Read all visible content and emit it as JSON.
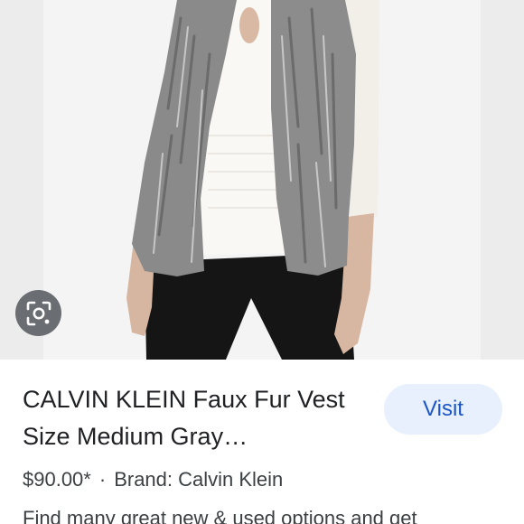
{
  "product": {
    "title": "CALVIN KLEIN Faux Fur Vest Size Medium Gray…",
    "price": "$90.00*",
    "separator": "·",
    "brand": "Brand: Calvin Klein",
    "description": "Find many great new & used options and get"
  },
  "actions": {
    "visit_label": "Visit",
    "lens_icon": "google-lens-icon"
  },
  "colors": {
    "visit_bg": "#e8f0fe",
    "visit_text": "#1a56c8",
    "lens_bg": "#5f6368",
    "text_primary": "#202124",
    "text_secondary": "#3c4043"
  }
}
